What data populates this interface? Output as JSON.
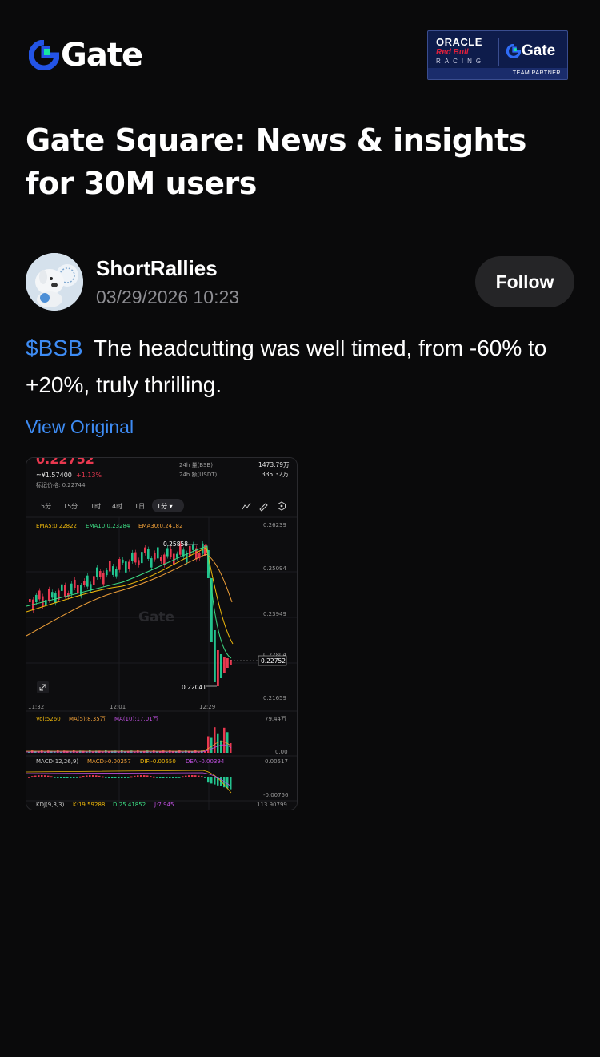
{
  "brand": {
    "name": "Gate",
    "accent_blue": "#2354e6",
    "accent_green": "#17e6a1"
  },
  "partner": {
    "oracle": "ORACLE",
    "redbull": "Red Bull",
    "racing": "RACING",
    "gate": "Gate",
    "team": "TEAM PARTNER"
  },
  "headline": "Gate Square: News & insights for 30M users",
  "author": {
    "name": "ShortRallies",
    "time": "03/29/2026 10:23",
    "follow_label": "Follow"
  },
  "post": {
    "ticker": "$BSB",
    "text": "The headcutting was well timed, from -60% to +20%, truly thrilling."
  },
  "view_original": "View Original",
  "screenshot": {
    "price_top": "0.22752",
    "approx": "≈¥1.57400",
    "change": "+1.13%",
    "mark_price": "标记价格: 0.22744",
    "vol_label": "24h 量(BSB)",
    "vol_value": "1473.79万",
    "turnover_label": "24h 额(USDT)",
    "turnover_value": "335.32万",
    "tabs": [
      "5分",
      "15分",
      "1时",
      "4时",
      "1日",
      "1分 ▾"
    ],
    "ema5": "EMA5:0.22822",
    "ema10": "EMA10:0.23284",
    "ema30": "EMA30:0.24182",
    "y_labels": [
      "0.26239",
      "0.25094",
      "0.23949",
      "0.22804",
      "0.21659"
    ],
    "high_label": "0.25858",
    "low_label": "0.22041",
    "last_price": "0.22752",
    "x_labels": [
      "11:32",
      "12:01",
      "12:29"
    ],
    "vol_line": "Vol:5260",
    "vol_ma5": "MA(5):8.35万",
    "vol_ma10": "MA(10):17.01万",
    "vol_max": "79.44万",
    "vol_zero": "0.00",
    "macd": "MACD(12,26,9)",
    "macd_val": "MACD:-0.00257",
    "dif": "DIF:-0.00650",
    "dea": "DEA:-0.00394",
    "macd_top": "0.00517",
    "macd_bottom": "-0.00756",
    "kdj": "KDJ(9,3,3)",
    "kdj_k": "K:19.59288",
    "kdj_d": "D:25.41852",
    "kdj_j": "J:7.945",
    "kdj_right": "113.90799",
    "watermark": "Gate"
  }
}
